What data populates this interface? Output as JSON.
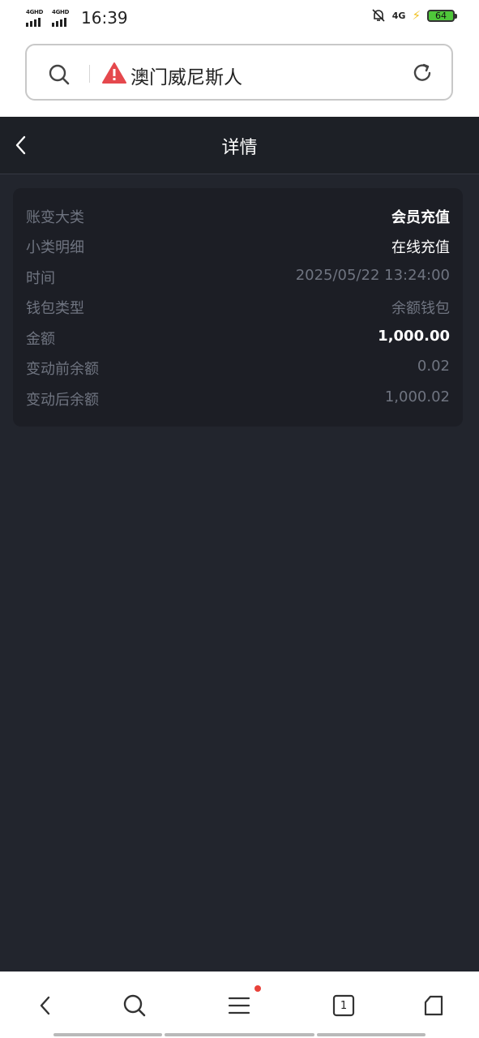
{
  "status_bar": {
    "time": "16:39",
    "signal1_label": "4GHD",
    "signal2_label": "4GHD",
    "network": "4G",
    "battery": "64"
  },
  "url_bar": {
    "title": "澳门威尼斯人",
    "warning_icon": "warning-icon",
    "search_icon": "search-icon",
    "reload_icon": "reload-icon"
  },
  "page": {
    "title": "详情",
    "back_icon": "back-arrow-icon"
  },
  "details": [
    {
      "label": "账变大类",
      "value": "会员充值"
    },
    {
      "label": "小类明细",
      "value": "在线充值"
    },
    {
      "label": "时间",
      "value": "2025/05/22 13:24:00"
    },
    {
      "label": "钱包类型",
      "value": "余额钱包"
    },
    {
      "label": "金额",
      "value": "1,000.00"
    },
    {
      "label": "变动前余额",
      "value": "0.02"
    },
    {
      "label": "变动后余额",
      "value": "1,000.02"
    }
  ],
  "bottom_bar": {
    "tab_count": "1",
    "icons": [
      "back-icon",
      "search-icon",
      "menu-icon",
      "tabs-icon",
      "home-icon"
    ]
  },
  "colors": {
    "background": "#22252d",
    "card": "#1c1e25",
    "label": "#6f7480",
    "highlight": "#ffffff",
    "notification_dot": "#e8423a",
    "warning": "#e5484d"
  }
}
